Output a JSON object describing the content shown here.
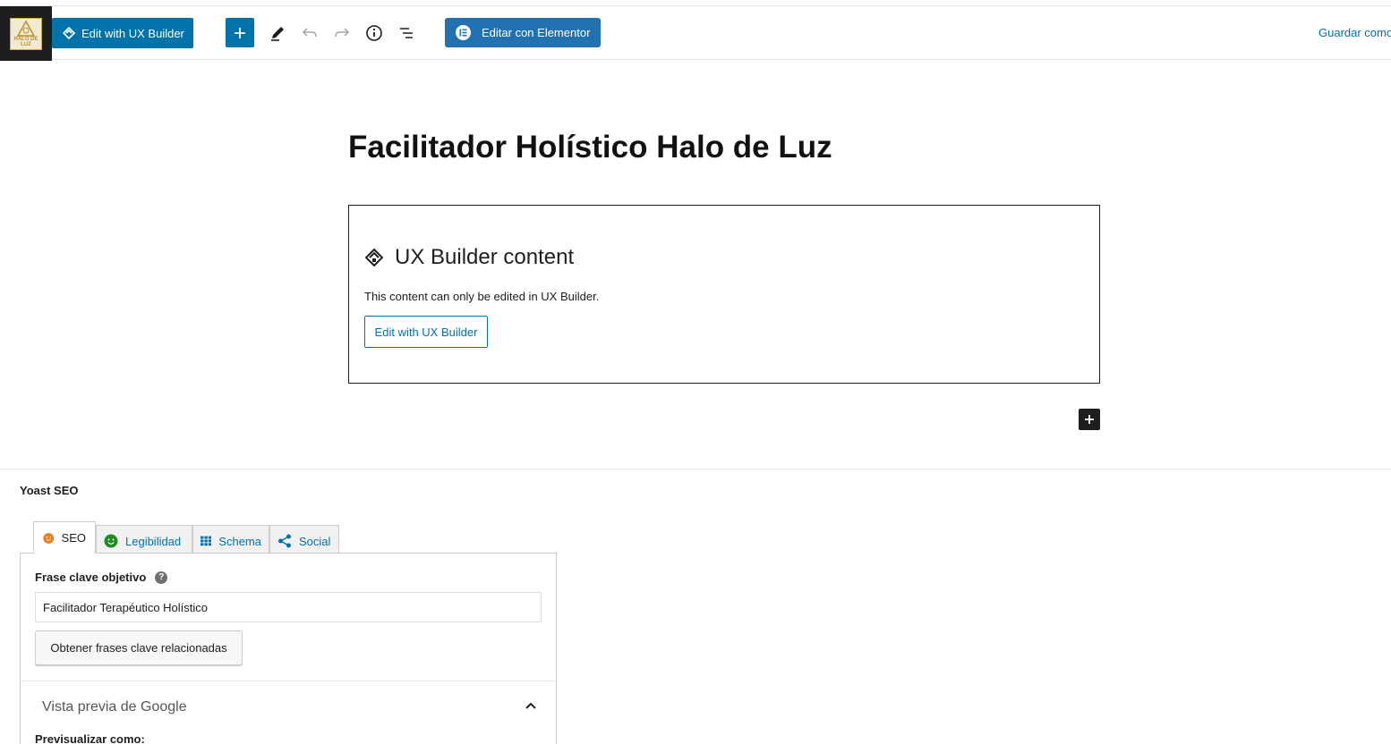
{
  "topbar": {
    "logo_text": "HALO DE LUZ",
    "ux_builder_label": "Edit with UX Builder",
    "elementor_label": "Editar con Elementor",
    "save_label": "Guardar como"
  },
  "post": {
    "title": "Facilitador Holístico Halo de Luz"
  },
  "ux_block": {
    "heading": "UX Builder content",
    "description": "This content can only be edited in UX Builder.",
    "button_label": "Edit with UX Builder"
  },
  "yoast": {
    "title": "Yoast SEO",
    "tabs": [
      {
        "label": "SEO",
        "status_color": "#ee7c1b"
      },
      {
        "label": "Legibilidad",
        "status_color": "#1e8c1e"
      },
      {
        "label": "Schema"
      },
      {
        "label": "Social"
      }
    ],
    "focus_keyphrase_label": "Frase clave objetivo",
    "focus_keyphrase_value": "Facilitador Terapéutico Holístico",
    "related_button_label": "Obtener frases clave relacionadas",
    "google_preview_title": "Vista previa de Google",
    "preview_as_label": "Previsualizar como:"
  },
  "colors": {
    "accent": "#0073aa",
    "elementor": "#2271b1",
    "dark": "#1e1e1e"
  }
}
